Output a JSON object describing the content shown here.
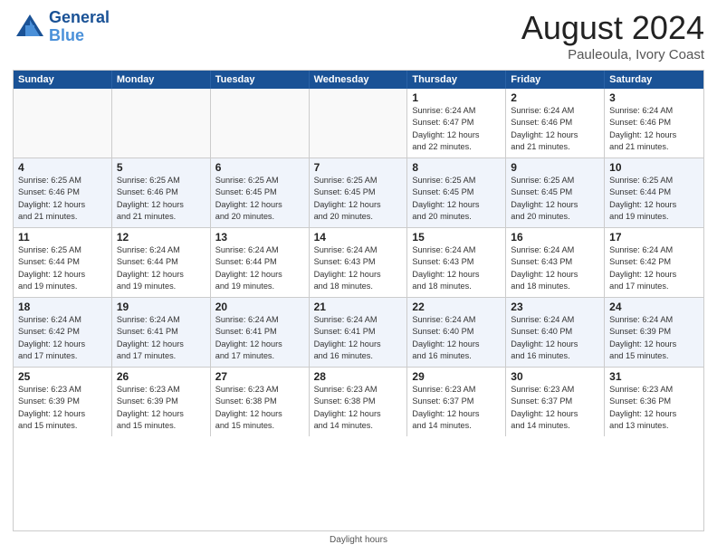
{
  "header": {
    "logo_line1": "General",
    "logo_line2": "Blue",
    "month_title": "August 2024",
    "location": "Pauleoula, Ivory Coast"
  },
  "days_of_week": [
    "Sunday",
    "Monday",
    "Tuesday",
    "Wednesday",
    "Thursday",
    "Friday",
    "Saturday"
  ],
  "footer": {
    "note": "Daylight hours"
  },
  "rows": [
    [
      {
        "day": "",
        "empty": true
      },
      {
        "day": "",
        "empty": true
      },
      {
        "day": "",
        "empty": true
      },
      {
        "day": "",
        "empty": true
      },
      {
        "day": "1",
        "lines": [
          "Sunrise: 6:24 AM",
          "Sunset: 6:47 PM",
          "Daylight: 12 hours",
          "and 22 minutes."
        ]
      },
      {
        "day": "2",
        "lines": [
          "Sunrise: 6:24 AM",
          "Sunset: 6:46 PM",
          "Daylight: 12 hours",
          "and 21 minutes."
        ]
      },
      {
        "day": "3",
        "lines": [
          "Sunrise: 6:24 AM",
          "Sunset: 6:46 PM",
          "Daylight: 12 hours",
          "and 21 minutes."
        ]
      }
    ],
    [
      {
        "day": "4",
        "lines": [
          "Sunrise: 6:25 AM",
          "Sunset: 6:46 PM",
          "Daylight: 12 hours",
          "and 21 minutes."
        ]
      },
      {
        "day": "5",
        "lines": [
          "Sunrise: 6:25 AM",
          "Sunset: 6:46 PM",
          "Daylight: 12 hours",
          "and 21 minutes."
        ]
      },
      {
        "day": "6",
        "lines": [
          "Sunrise: 6:25 AM",
          "Sunset: 6:45 PM",
          "Daylight: 12 hours",
          "and 20 minutes."
        ]
      },
      {
        "day": "7",
        "lines": [
          "Sunrise: 6:25 AM",
          "Sunset: 6:45 PM",
          "Daylight: 12 hours",
          "and 20 minutes."
        ]
      },
      {
        "day": "8",
        "lines": [
          "Sunrise: 6:25 AM",
          "Sunset: 6:45 PM",
          "Daylight: 12 hours",
          "and 20 minutes."
        ]
      },
      {
        "day": "9",
        "lines": [
          "Sunrise: 6:25 AM",
          "Sunset: 6:45 PM",
          "Daylight: 12 hours",
          "and 20 minutes."
        ]
      },
      {
        "day": "10",
        "lines": [
          "Sunrise: 6:25 AM",
          "Sunset: 6:44 PM",
          "Daylight: 12 hours",
          "and 19 minutes."
        ]
      }
    ],
    [
      {
        "day": "11",
        "lines": [
          "Sunrise: 6:25 AM",
          "Sunset: 6:44 PM",
          "Daylight: 12 hours",
          "and 19 minutes."
        ]
      },
      {
        "day": "12",
        "lines": [
          "Sunrise: 6:24 AM",
          "Sunset: 6:44 PM",
          "Daylight: 12 hours",
          "and 19 minutes."
        ]
      },
      {
        "day": "13",
        "lines": [
          "Sunrise: 6:24 AM",
          "Sunset: 6:44 PM",
          "Daylight: 12 hours",
          "and 19 minutes."
        ]
      },
      {
        "day": "14",
        "lines": [
          "Sunrise: 6:24 AM",
          "Sunset: 6:43 PM",
          "Daylight: 12 hours",
          "and 18 minutes."
        ]
      },
      {
        "day": "15",
        "lines": [
          "Sunrise: 6:24 AM",
          "Sunset: 6:43 PM",
          "Daylight: 12 hours",
          "and 18 minutes."
        ]
      },
      {
        "day": "16",
        "lines": [
          "Sunrise: 6:24 AM",
          "Sunset: 6:43 PM",
          "Daylight: 12 hours",
          "and 18 minutes."
        ]
      },
      {
        "day": "17",
        "lines": [
          "Sunrise: 6:24 AM",
          "Sunset: 6:42 PM",
          "Daylight: 12 hours",
          "and 17 minutes."
        ]
      }
    ],
    [
      {
        "day": "18",
        "lines": [
          "Sunrise: 6:24 AM",
          "Sunset: 6:42 PM",
          "Daylight: 12 hours",
          "and 17 minutes."
        ]
      },
      {
        "day": "19",
        "lines": [
          "Sunrise: 6:24 AM",
          "Sunset: 6:41 PM",
          "Daylight: 12 hours",
          "and 17 minutes."
        ]
      },
      {
        "day": "20",
        "lines": [
          "Sunrise: 6:24 AM",
          "Sunset: 6:41 PM",
          "Daylight: 12 hours",
          "and 17 minutes."
        ]
      },
      {
        "day": "21",
        "lines": [
          "Sunrise: 6:24 AM",
          "Sunset: 6:41 PM",
          "Daylight: 12 hours",
          "and 16 minutes."
        ]
      },
      {
        "day": "22",
        "lines": [
          "Sunrise: 6:24 AM",
          "Sunset: 6:40 PM",
          "Daylight: 12 hours",
          "and 16 minutes."
        ]
      },
      {
        "day": "23",
        "lines": [
          "Sunrise: 6:24 AM",
          "Sunset: 6:40 PM",
          "Daylight: 12 hours",
          "and 16 minutes."
        ]
      },
      {
        "day": "24",
        "lines": [
          "Sunrise: 6:24 AM",
          "Sunset: 6:39 PM",
          "Daylight: 12 hours",
          "and 15 minutes."
        ]
      }
    ],
    [
      {
        "day": "25",
        "lines": [
          "Sunrise: 6:23 AM",
          "Sunset: 6:39 PM",
          "Daylight: 12 hours",
          "and 15 minutes."
        ]
      },
      {
        "day": "26",
        "lines": [
          "Sunrise: 6:23 AM",
          "Sunset: 6:39 PM",
          "Daylight: 12 hours",
          "and 15 minutes."
        ]
      },
      {
        "day": "27",
        "lines": [
          "Sunrise: 6:23 AM",
          "Sunset: 6:38 PM",
          "Daylight: 12 hours",
          "and 15 minutes."
        ]
      },
      {
        "day": "28",
        "lines": [
          "Sunrise: 6:23 AM",
          "Sunset: 6:38 PM",
          "Daylight: 12 hours",
          "and 14 minutes."
        ]
      },
      {
        "day": "29",
        "lines": [
          "Sunrise: 6:23 AM",
          "Sunset: 6:37 PM",
          "Daylight: 12 hours",
          "and 14 minutes."
        ]
      },
      {
        "day": "30",
        "lines": [
          "Sunrise: 6:23 AM",
          "Sunset: 6:37 PM",
          "Daylight: 12 hours",
          "and 14 minutes."
        ]
      },
      {
        "day": "31",
        "lines": [
          "Sunrise: 6:23 AM",
          "Sunset: 6:36 PM",
          "Daylight: 12 hours",
          "and 13 minutes."
        ]
      }
    ]
  ]
}
